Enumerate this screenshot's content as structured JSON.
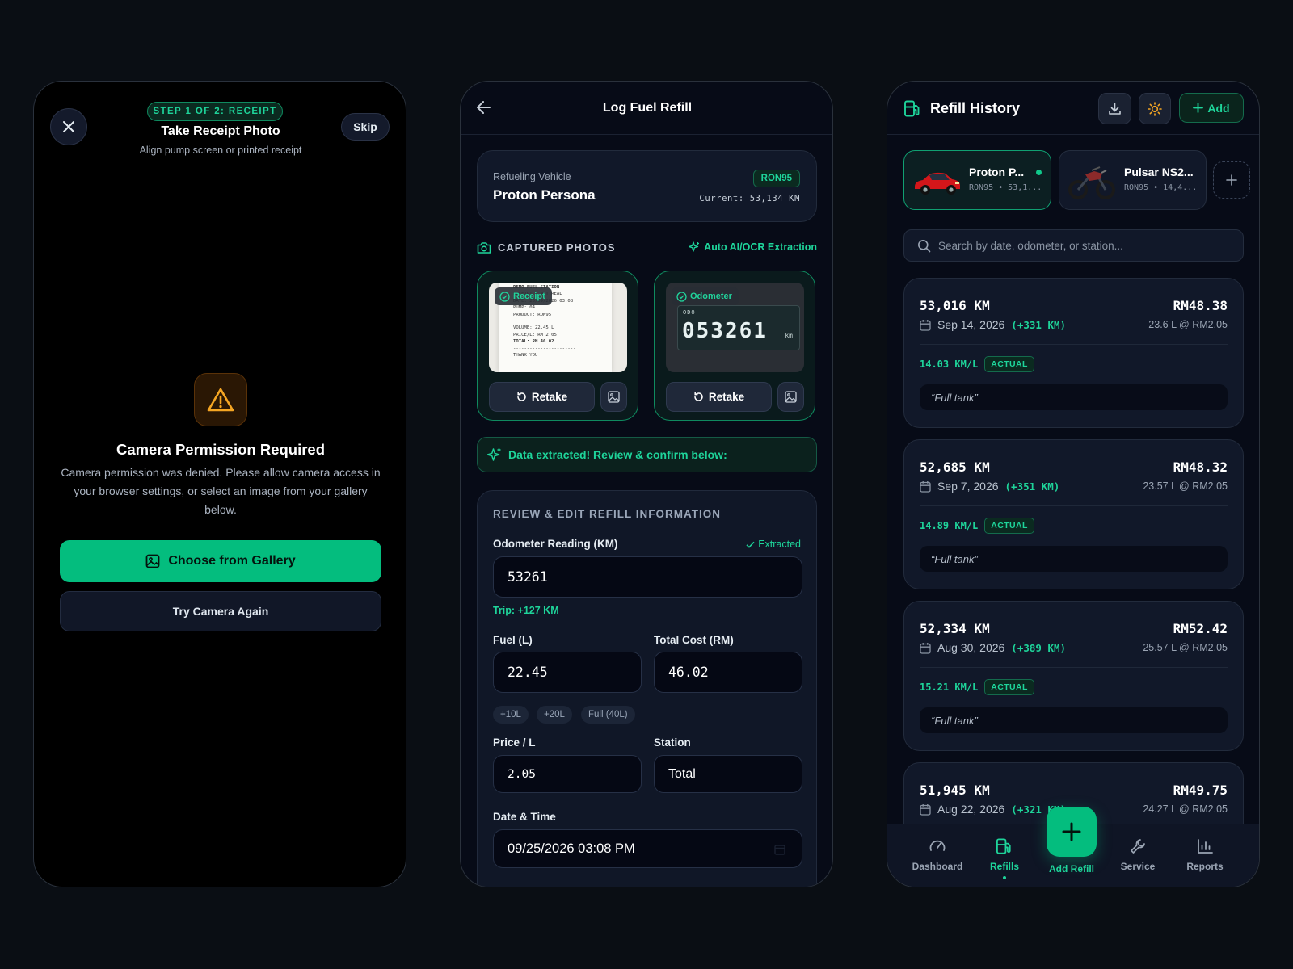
{
  "colors": {
    "accent": "#04bd7e",
    "accent_text": "#1ed49a",
    "warning": "#f5a623",
    "background": "#0a0e14",
    "panel": "#111829"
  },
  "camera": {
    "step_badge": "STEP 1 OF 2: RECEIPT",
    "title": "Take Receipt Photo",
    "subtitle": "Align pump screen or printed receipt",
    "skip_label": "Skip",
    "close_icon": "close-icon",
    "warning_icon": "warning-triangle-icon",
    "permission_title": "Camera Permission Required",
    "permission_message": "Camera permission was denied. Please allow camera access in your browser settings, or select an image from your gallery below.",
    "gallery_button": "Choose from Gallery",
    "retry_button": "Try Camera Again"
  },
  "log_refill": {
    "title": "Log Fuel Refill",
    "vehicle_label": "Refueling Vehicle",
    "vehicle_name": "Proton Persona",
    "fuel_badge": "RON95",
    "current_odometer": "Current: 53,134 KM",
    "captured_label": "CAPTURED PHOTOS",
    "auto_label": "Auto AI/OCR Extraction",
    "photos": [
      {
        "tag": "Receipt",
        "retake": "Retake"
      },
      {
        "tag": "Odometer",
        "retake": "Retake",
        "odo_prefix": "ODO",
        "odo_value": "053261",
        "odo_unit": "km"
      }
    ],
    "receipt_lines": [
      "DEMO FUEL STATION",
      "RECEIPT - NOT REAL",
      "DATE: 25/09/2026 03:08",
      "PUMP: 04",
      "PRODUCT: RON95",
      "-----------------------",
      "VOLUME: 22.45 L",
      "PRICE/L: RM 2.05",
      "TOTAL: RM 46.02",
      "-----------------------",
      "THANK YOU"
    ],
    "extracted_banner": "Data extracted! Review & confirm below:",
    "review_title": "REVIEW & EDIT REFILL INFORMATION",
    "odometer_label": "Odometer Reading (KM)",
    "extracted_tag": "Extracted",
    "odometer_value": "53261",
    "trip_text": "Trip: +127 KM",
    "fuel_label": "Fuel (L)",
    "fuel_value": "22.45",
    "cost_label": "Total Cost (RM)",
    "cost_value": "46.02",
    "quick_chips": [
      "+10L",
      "+20L",
      "Full (40L)"
    ],
    "price_label": "Price / L",
    "price_value": "2.05",
    "station_label": "Station",
    "station_value": "Total",
    "datetime_label": "Date & Time",
    "datetime_value": "09/25/2026 03:08 PM"
  },
  "history": {
    "title": "Refill History",
    "add_label": "Add",
    "vehicles": [
      {
        "name": "Proton P...",
        "sub": "RON95 • 53,1...",
        "active": true
      },
      {
        "name": "Pulsar NS2...",
        "sub": "RON95 • 14,4...",
        "active": false
      }
    ],
    "search_placeholder": "Search by date, odometer, or station...",
    "records": [
      {
        "km": "53,016 KM",
        "cost": "RM48.38",
        "date": "Sep 14, 2026",
        "delta": "(+331 KM)",
        "litres": "23.6 L @ RM2.05",
        "efficiency": "14.03 KM/L",
        "type": "ACTUAL",
        "note": "“Full tank”"
      },
      {
        "km": "52,685 KM",
        "cost": "RM48.32",
        "date": "Sep 7, 2026",
        "delta": "(+351 KM)",
        "litres": "23.57 L @ RM2.05",
        "efficiency": "14.89 KM/L",
        "type": "ACTUAL",
        "note": "“Full tank”"
      },
      {
        "km": "52,334 KM",
        "cost": "RM52.42",
        "date": "Aug 30, 2026",
        "delta": "(+389 KM)",
        "litres": "25.57 L @ RM2.05",
        "efficiency": "15.21 KM/L",
        "type": "ACTUAL",
        "note": "“Full tank”"
      },
      {
        "km": "51,945 KM",
        "cost": "RM49.75",
        "date": "Aug 22, 2026",
        "delta": "(+321 KM)",
        "litres": "24.27 L @ RM2.05"
      }
    ],
    "nav": [
      {
        "label": "Dashboard",
        "icon": "gauge-icon"
      },
      {
        "label": "Refills",
        "icon": "fuel-pump-icon",
        "active": true
      },
      {
        "label": "Add Refill",
        "icon": "plus-icon"
      },
      {
        "label": "Service",
        "icon": "wrench-icon"
      },
      {
        "label": "Reports",
        "icon": "bar-chart-icon"
      }
    ]
  }
}
